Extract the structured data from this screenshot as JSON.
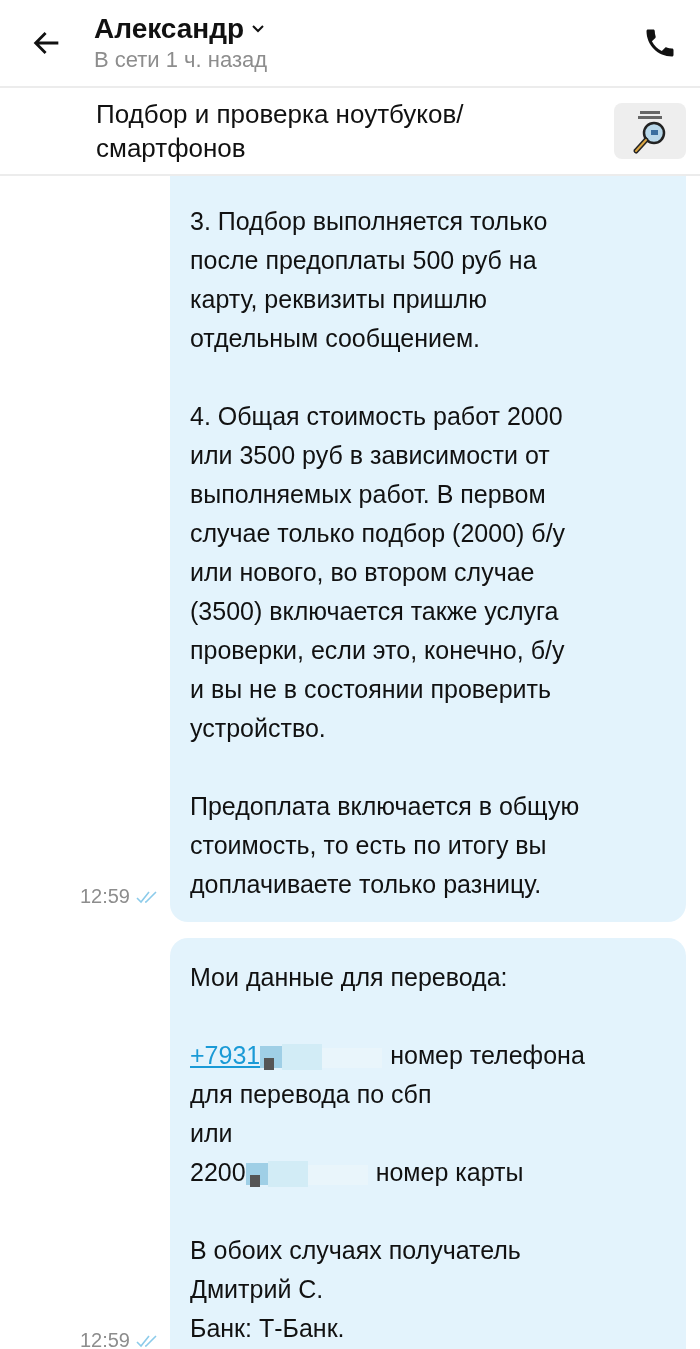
{
  "header": {
    "name": "Александр",
    "status": "В сети 1 ч. назад"
  },
  "topic": {
    "title": "Подбор и проверка ноутбуков/\nсмартфонов"
  },
  "messages": [
    {
      "time": "12:59",
      "read": true,
      "continued": true,
      "paragraphs": [
        [
          [
            {
              "kind": "text",
              "text": "3. Подбор выполняется только"
            }
          ],
          [
            {
              "kind": "text",
              "text": "после предоплаты 500 руб на"
            }
          ],
          [
            {
              "kind": "text",
              "text": "карту, реквизиты пришлю"
            }
          ],
          [
            {
              "kind": "text",
              "text": "отдельным сообщением."
            }
          ]
        ],
        [
          [
            {
              "kind": "text",
              "text": "4. Общая стоимость работ 2000"
            }
          ],
          [
            {
              "kind": "text",
              "text": "или 3500 руб в зависимости от"
            }
          ],
          [
            {
              "kind": "text",
              "text": "выполняемых работ. В первом"
            }
          ],
          [
            {
              "kind": "text",
              "text": "случае только подбор (2000) б/у"
            }
          ],
          [
            {
              "kind": "text",
              "text": "или нового, во втором случае"
            }
          ],
          [
            {
              "kind": "text",
              "text": "(3500) включается также услуга"
            }
          ],
          [
            {
              "kind": "text",
              "text": "проверки, если это, конечно, б/у"
            }
          ],
          [
            {
              "kind": "text",
              "text": "и вы не в состоянии проверить"
            }
          ],
          [
            {
              "kind": "text",
              "text": "устройство."
            }
          ]
        ],
        [
          [
            {
              "kind": "text",
              "text": "Предоплата включается в общую"
            }
          ],
          [
            {
              "kind": "text",
              "text": "стоимость, то есть по итогу вы"
            }
          ],
          [
            {
              "kind": "text",
              "text": "доплачиваете только разницу."
            }
          ]
        ]
      ]
    },
    {
      "time": "12:59",
      "read": true,
      "continued": false,
      "paragraphs": [
        [
          [
            {
              "kind": "text",
              "text": "Мои данные для перевода:"
            }
          ]
        ],
        [
          [
            {
              "kind": "link",
              "text": "+7931"
            },
            {
              "kind": "redacted"
            },
            {
              "kind": "text",
              "text": "номер телефона"
            }
          ],
          [
            {
              "kind": "text",
              "text": "для перевода по сбп"
            }
          ],
          [
            {
              "kind": "text",
              "text": "или"
            }
          ],
          [
            {
              "kind": "text",
              "text": "2200"
            },
            {
              "kind": "redacted"
            },
            {
              "kind": "text",
              "text": "номер карты"
            }
          ]
        ],
        [
          [
            {
              "kind": "text",
              "text": "В обоих случаях получатель"
            }
          ],
          [
            {
              "kind": "text",
              "text": "Дмитрий С."
            }
          ],
          [
            {
              "kind": "text",
              "text": "Банк: Т-Банк."
            }
          ]
        ]
      ]
    }
  ]
}
